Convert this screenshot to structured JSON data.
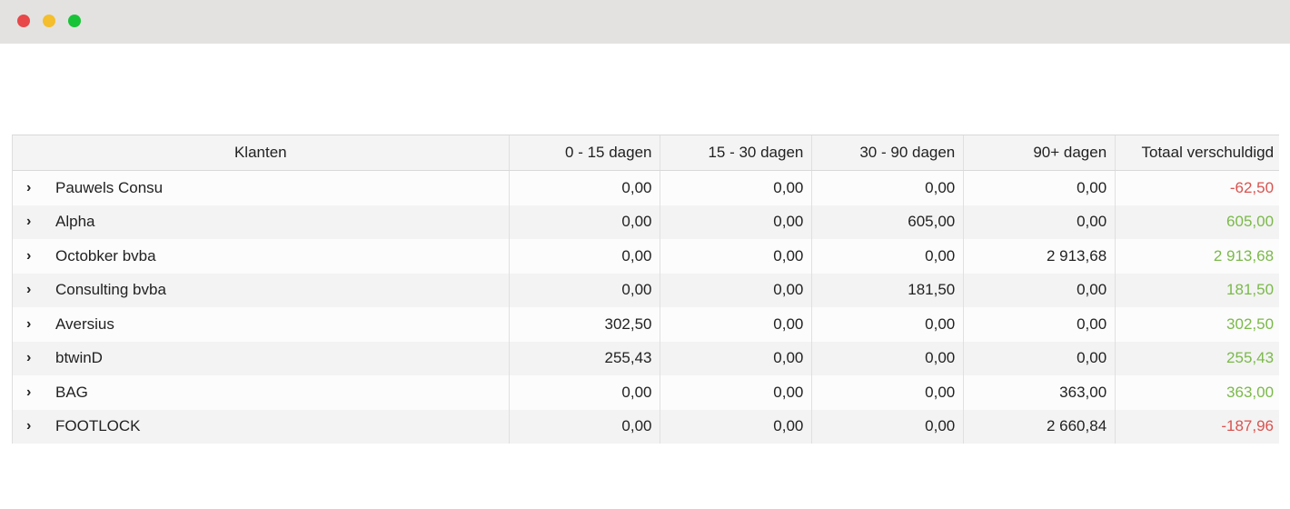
{
  "window": {
    "controls": [
      "close",
      "minimize",
      "maximize"
    ]
  },
  "colors": {
    "negative": "#d9534f",
    "positive": "#7bb94a"
  },
  "table": {
    "columns": [
      "Klanten",
      "0 - 15 dagen",
      "15 - 30 dagen",
      "30 - 90 dagen",
      "90+ dagen",
      "Totaal verschuldigd"
    ],
    "rows": [
      {
        "name": "Pauwels Consu",
        "d0_15": "0,00",
        "d15_30": "0,00",
        "d30_90": "0,00",
        "d90": "0,00",
        "total": "-62,50",
        "sign": "negative"
      },
      {
        "name": "Alpha",
        "d0_15": "0,00",
        "d15_30": "0,00",
        "d30_90": "605,00",
        "d90": "0,00",
        "total": "605,00",
        "sign": "positive"
      },
      {
        "name": "Octobker bvba",
        "d0_15": "0,00",
        "d15_30": "0,00",
        "d30_90": "0,00",
        "d90": "2 913,68",
        "total": "2 913,68",
        "sign": "positive"
      },
      {
        "name": "Consulting bvba",
        "d0_15": "0,00",
        "d15_30": "0,00",
        "d30_90": "181,50",
        "d90": "0,00",
        "total": "181,50",
        "sign": "positive"
      },
      {
        "name": "Aversius",
        "d0_15": "302,50",
        "d15_30": "0,00",
        "d30_90": "0,00",
        "d90": "0,00",
        "total": "302,50",
        "sign": "positive"
      },
      {
        "name": "btwinD",
        "d0_15": "255,43",
        "d15_30": "0,00",
        "d30_90": "0,00",
        "d90": "0,00",
        "total": "255,43",
        "sign": "positive"
      },
      {
        "name": "BAG",
        "d0_15": "0,00",
        "d15_30": "0,00",
        "d30_90": "0,00",
        "d90": "363,00",
        "total": "363,00",
        "sign": "positive"
      },
      {
        "name": "FOOTLOCK",
        "d0_15": "0,00",
        "d15_30": "0,00",
        "d30_90": "0,00",
        "d90": "2 660,84",
        "total": "-187,96",
        "sign": "negative"
      }
    ],
    "expand_icon": "chevron-right-icon"
  }
}
